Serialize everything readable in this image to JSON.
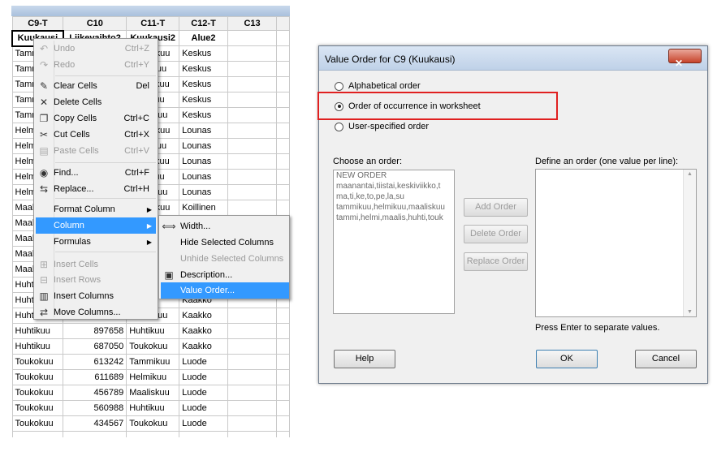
{
  "worksheet": {
    "columns": [
      "C9-T",
      "C10",
      "C11-T",
      "C12-T",
      "C13"
    ],
    "names": [
      "Kuukausi",
      "Liikevaihto2",
      "Kuukausi2",
      "Alue2",
      ""
    ],
    "rows": [
      [
        "Tammikuu",
        "",
        "Tammikuu",
        "Keskus"
      ],
      [
        "Tammikuu",
        "",
        "Helmikuu",
        "Keskus"
      ],
      [
        "Tammikuu",
        "",
        "Maaliskuu",
        "Keskus"
      ],
      [
        "Tammikuu",
        "",
        "Huhtikuu",
        "Keskus"
      ],
      [
        "Tammikuu",
        "",
        "Toukokuu",
        "Keskus"
      ],
      [
        "Helmikuu",
        "",
        "Tammikuu",
        "Lounas"
      ],
      [
        "Helmikuu",
        "",
        "Helmikuu",
        "Lounas"
      ],
      [
        "Helmikuu",
        "",
        "Maaliskuu",
        "Lounas"
      ],
      [
        "Helmikuu",
        "",
        "Huhtikuu",
        "Lounas"
      ],
      [
        "Helmikuu",
        "",
        "Toukokuu",
        "Lounas"
      ],
      [
        "Maaliskuu",
        "",
        "Tammikuu",
        "Koillinen"
      ],
      [
        "Maaliskuu",
        "",
        "",
        ""
      ],
      [
        "Maaliskuu",
        "",
        "",
        ""
      ],
      [
        "Maaliskuu",
        "",
        "",
        ""
      ],
      [
        "Maaliskuu",
        "",
        "",
        ""
      ],
      [
        "Huhtikuu",
        "",
        "",
        ""
      ],
      [
        "Huhtikuu",
        "",
        "",
        "Kaakko"
      ],
      [
        "Huhtikuu",
        "",
        "Toukokuu",
        "Kaakko"
      ],
      [
        "Huhtikuu",
        "897658",
        "Huhtikuu",
        "Kaakko"
      ],
      [
        "Huhtikuu",
        "687050",
        "Toukokuu",
        "Kaakko"
      ],
      [
        "Toukokuu",
        "613242",
        "Tammikuu",
        "Luode"
      ],
      [
        "Toukokuu",
        "611689",
        "Helmikuu",
        "Luode"
      ],
      [
        "Toukokuu",
        "456789",
        "Maaliskuu",
        "Luode"
      ],
      [
        "Toukokuu",
        "560988",
        "Huhtikuu",
        "Luode"
      ],
      [
        "Toukokuu",
        "434567",
        "Toukokuu",
        "Luode"
      ],
      [
        "",
        "",
        "",
        ""
      ]
    ]
  },
  "context_menu": {
    "items": [
      {
        "label": "Undo",
        "shortcut": "Ctrl+Z",
        "icon": "undo-icon",
        "glyph": "↶",
        "disabled": true
      },
      {
        "label": "Redo",
        "shortcut": "Ctrl+Y",
        "icon": "redo-icon",
        "glyph": "↷",
        "disabled": true
      },
      {
        "label": "Clear Cells",
        "shortcut": "Del",
        "icon": "eraser-icon",
        "glyph": "✎",
        "disabled": false
      },
      {
        "label": "Delete Cells",
        "shortcut": "",
        "icon": "delete-x-icon",
        "glyph": "✕",
        "disabled": false
      },
      {
        "label": "Copy Cells",
        "shortcut": "Ctrl+C",
        "icon": "copy-icon",
        "glyph": "❐",
        "disabled": false
      },
      {
        "label": "Cut Cells",
        "shortcut": "Ctrl+X",
        "icon": "scissors-icon",
        "glyph": "✂",
        "disabled": false
      },
      {
        "label": "Paste Cells",
        "shortcut": "Ctrl+V",
        "icon": "paste-icon",
        "glyph": "▤",
        "disabled": true
      },
      {
        "label": "Find...",
        "shortcut": "Ctrl+F",
        "icon": "binoculars-icon",
        "glyph": "◉",
        "disabled": false
      },
      {
        "label": "Replace...",
        "shortcut": "Ctrl+H",
        "icon": "replace-icon",
        "glyph": "⇆",
        "disabled": false
      },
      {
        "label": "Format Column",
        "shortcut": "",
        "icon": "",
        "glyph": "",
        "disabled": false,
        "submenu": true
      },
      {
        "label": "Column",
        "shortcut": "",
        "icon": "",
        "glyph": "",
        "disabled": false,
        "submenu": true,
        "highlighted": true
      },
      {
        "label": "Formulas",
        "shortcut": "",
        "icon": "",
        "glyph": "",
        "disabled": false,
        "submenu": true
      },
      {
        "label": "Insert Cells",
        "shortcut": "",
        "icon": "insert-cells-icon",
        "glyph": "⊞",
        "disabled": true
      },
      {
        "label": "Insert Rows",
        "shortcut": "",
        "icon": "insert-rows-icon",
        "glyph": "⊟",
        "disabled": true
      },
      {
        "label": "Insert Columns",
        "shortcut": "",
        "icon": "insert-columns-icon",
        "glyph": "▥",
        "disabled": false
      },
      {
        "label": "Move Columns...",
        "shortcut": "",
        "icon": "move-columns-icon",
        "glyph": "⇄",
        "disabled": false
      }
    ]
  },
  "column_submenu": {
    "items": [
      {
        "label": "Width...",
        "icon": "column-width-icon",
        "glyph": "⟺",
        "disabled": false
      },
      {
        "label": "Hide Selected Columns",
        "icon": "",
        "glyph": "",
        "disabled": false
      },
      {
        "label": "Unhide Selected Columns",
        "icon": "",
        "glyph": "",
        "disabled": true
      },
      {
        "label": "Description...",
        "icon": "description-icon",
        "glyph": "▣",
        "disabled": false
      },
      {
        "label": "Value Order...",
        "icon": "",
        "glyph": "",
        "disabled": false,
        "highlighted": true
      }
    ]
  },
  "dialog": {
    "title": "Value Order for C9 (Kuukausi)",
    "close_glyph": "✕",
    "radios": [
      {
        "label": "Alphabetical order",
        "selected": false
      },
      {
        "label": "Order of occurrence in worksheet",
        "selected": true
      },
      {
        "label": "User-specified order",
        "selected": false
      }
    ],
    "choose_label": "Choose an order:",
    "choose_lines": [
      "NEW ORDER",
      "maanantai,tiistai,keskiviikko,t",
      "ma,ti,ke,to,pe,la,su",
      "tammikuu,helmikuu,maaliskuu",
      "tammi,helmi,maalis,huhti,touk"
    ],
    "define_label": "Define an order (one value per line):",
    "hint": "Press Enter to separate values.",
    "buttons": {
      "add_order": "Add Order",
      "delete_order": "Delete Order",
      "replace_order": "Replace Order",
      "help": "Help",
      "ok": "OK",
      "cancel": "Cancel"
    }
  },
  "colors": {
    "highlight": "#3399ff",
    "annotation": "#e02020"
  }
}
